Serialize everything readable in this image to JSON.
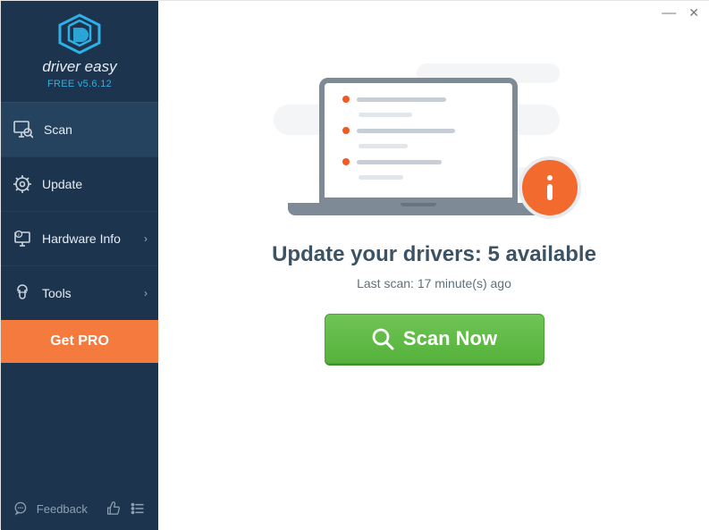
{
  "titlebar": {
    "minimize": "—",
    "close": "✕"
  },
  "brand": {
    "name": "driver easy",
    "version": "FREE v5.6.12"
  },
  "nav": {
    "scan": "Scan",
    "update": "Update",
    "hardware": "Hardware Info",
    "tools": "Tools"
  },
  "getpro": "Get PRO",
  "footer": {
    "feedback": "Feedback"
  },
  "main": {
    "headline_prefix": "Update your drivers: ",
    "headline_count": "5",
    "headline_suffix": " available",
    "subline": "Last scan: 17 minute(s) ago",
    "scan_button": "Scan Now"
  }
}
